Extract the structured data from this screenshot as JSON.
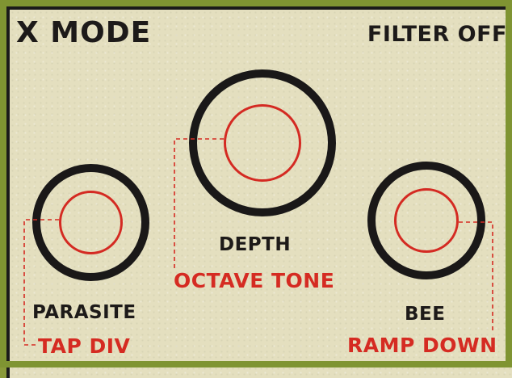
{
  "header": {
    "mode_title": "X MODE",
    "filter_state": "FILTER OFF"
  },
  "knobs": {
    "left": {
      "primary_label": "PARASITE",
      "secondary_label": "TAP DIV"
    },
    "center": {
      "primary_label": "DEPTH",
      "secondary_label": "OCTAVE TONE"
    },
    "right": {
      "primary_label": "BEE",
      "secondary_label": "RAMP DOWN"
    }
  },
  "colors": {
    "panel": "#e4dfbf",
    "frame": "#7f9432",
    "ink": "#1d1a19",
    "accent_red": "#d52b22"
  }
}
